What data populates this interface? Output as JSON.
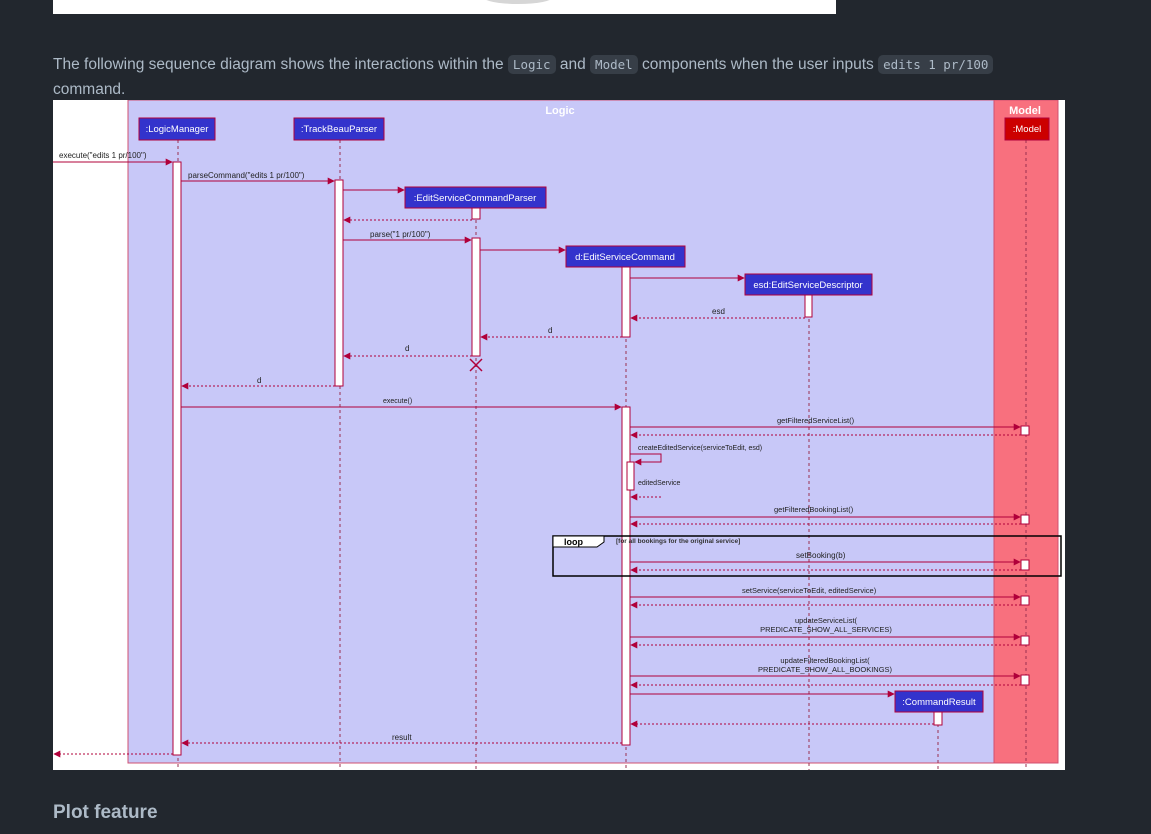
{
  "intro": {
    "before": "The following sequence diagram shows the interactions within the ",
    "code_logic": "Logic",
    "and": " and ",
    "code_model": "Model",
    "middle": " components when the user inputs ",
    "code_cmd": "edits 1 pr/100",
    "after": " command."
  },
  "diagram": {
    "frames": {
      "logic": "Logic",
      "model": "Model"
    },
    "participants": {
      "logic_manager": ":LogicManager",
      "parser": ":TrackBeauParser",
      "escp": ":EditServiceCommandParser",
      "command": "d:EditServiceCommand",
      "descriptor": "esd:EditServiceDescriptor",
      "model": ":Model",
      "result": ":CommandResult"
    },
    "messages": {
      "execute_call": "execute(\"edits 1 pr/100\")",
      "parse_command": "parseCommand(\"edits 1 pr/100\")",
      "parse": "parse(\"1 pr/100\")",
      "esd_return": "esd",
      "d_return_1": "d",
      "d_return_2": "d",
      "d_return_3": "d",
      "execute": "execute()",
      "get_filtered_service": "getFilteredServiceList()",
      "create_edited": "createEditedService(serviceToEdit, esd)",
      "edited_service": "editedService",
      "get_filtered_booking": "getFilteredBookingList()",
      "set_booking": "setBooking(b)",
      "set_service": "setService(serviceToEdit, editedService)",
      "update_service_1": "updateServiceList(",
      "update_service_2": "PREDICATE_SHOW_ALL_SERVICES)",
      "update_booking_1": "updateFilteredBookingList(",
      "update_booking_2": "PREDICATE_SHOW_ALL_BOOKINGS)",
      "result": "result"
    },
    "loop": {
      "label": "loop",
      "guard": "[for all bookings for the original service]"
    },
    "colors": {
      "logic_frame": "#c8c8f8",
      "model_frame": "#f8707e",
      "participant_box": "#3333cc",
      "model_box": "#cc0000",
      "arrow": "#b0003a"
    }
  },
  "next_section": {
    "heading": "Plot feature"
  }
}
